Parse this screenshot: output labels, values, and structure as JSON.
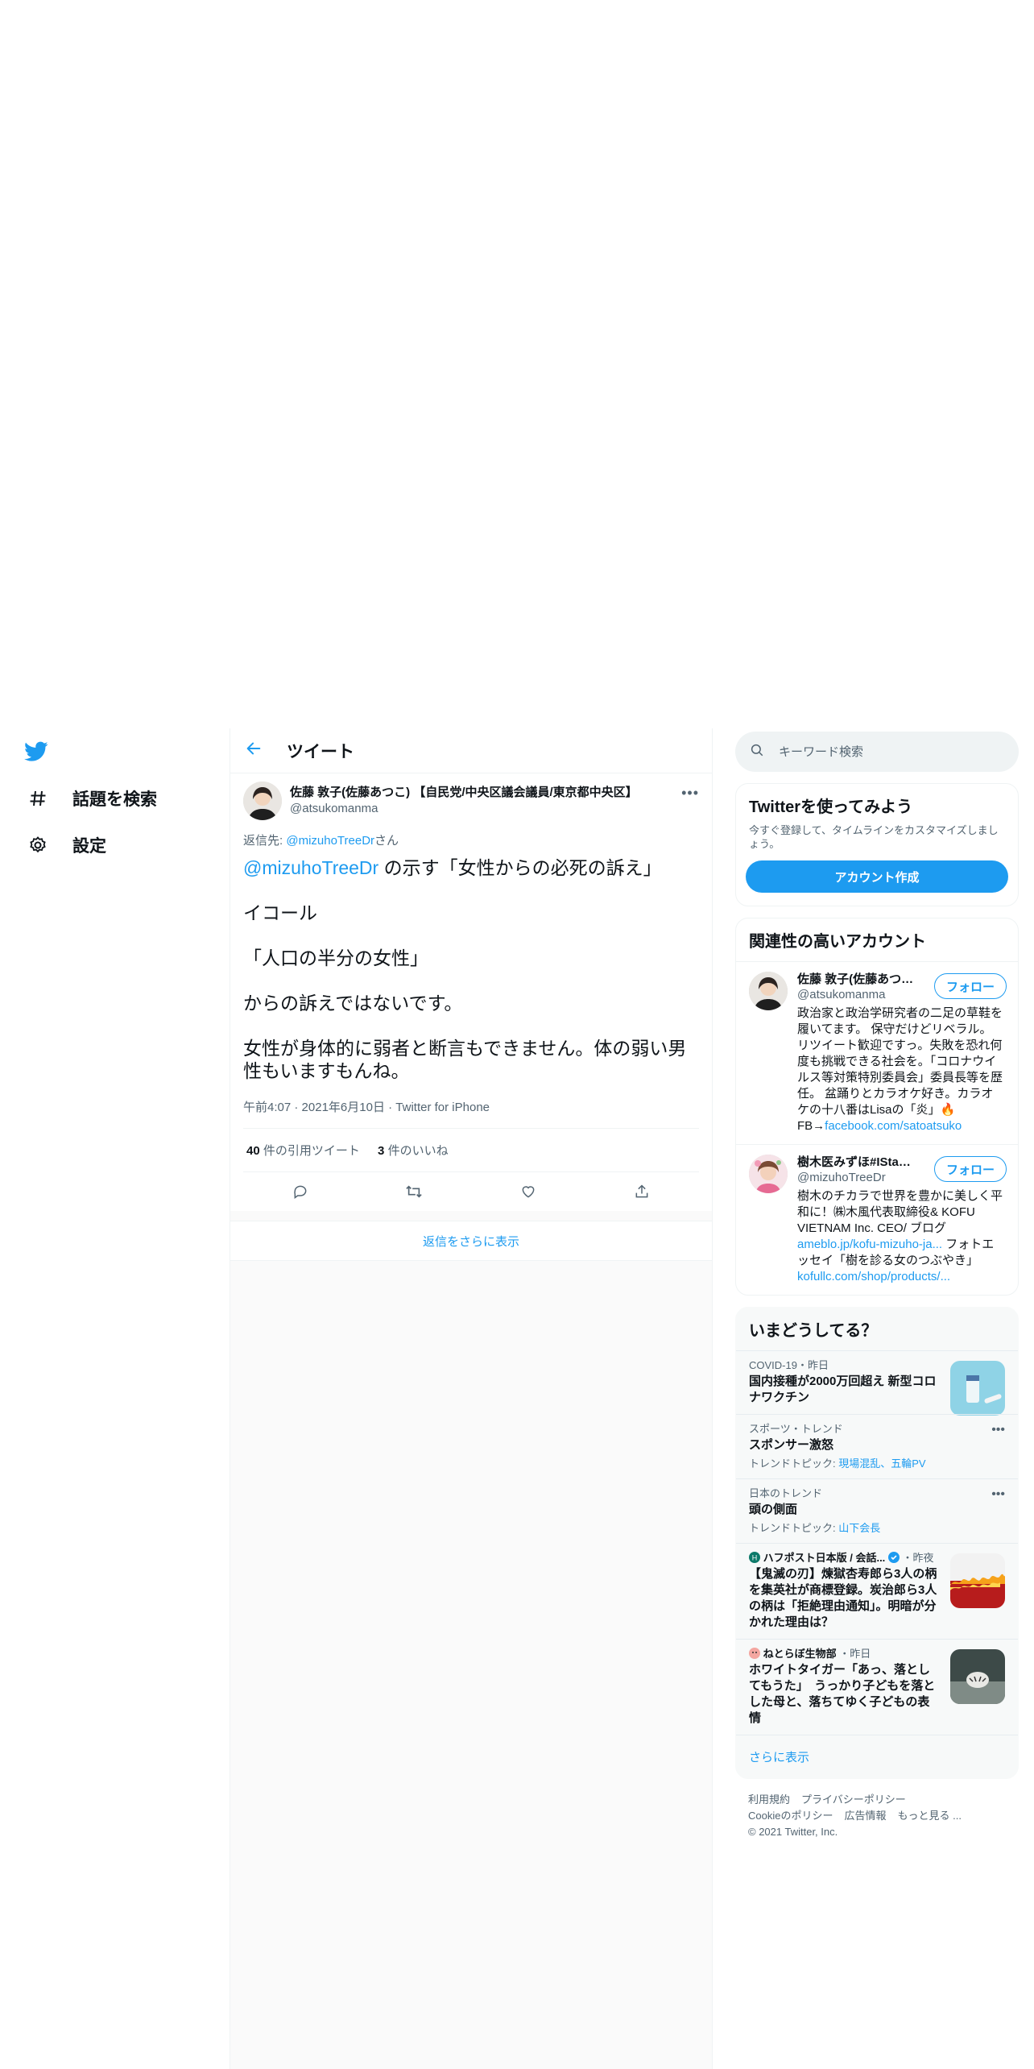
{
  "nav": {
    "logo": "twitter-bird",
    "items": [
      {
        "icon": "hash-icon",
        "label": "話題を検索"
      },
      {
        "icon": "gear-icon",
        "label": "設定"
      }
    ]
  },
  "header": {
    "title": "ツイート"
  },
  "tweet": {
    "author_name": "佐藤 敦子(佐藤あつこ) 【自民党/中央区議会議員/東京都中央区】",
    "author_handle": "@atsukomanma",
    "reply_prefix": "返信先: ",
    "reply_handle": "@mizuhoTreeDr",
    "reply_suffix": "さん",
    "mention": "@mizuhoTreeDr",
    "line1_rest": " の示す「女性からの必死の訴え」",
    "line2": "イコール",
    "line3": "「人口の半分の女性」",
    "line4": "からの訴えではないです。",
    "line5": "女性が身体的に弱者と断言もできません。体の弱い男性もいますもんね。",
    "time": "午前4:07",
    "date": "2021年6月10日",
    "source": "Twitter for iPhone",
    "quote_count": "40",
    "quote_label": "件の引用ツイート",
    "like_count": "3",
    "like_label": "件のいいね"
  },
  "more_replies": "返信をさらに表示",
  "search": {
    "placeholder": "キーワード検索"
  },
  "signup": {
    "title": "Twitterを使ってみよう",
    "desc": "今すぐ登録して、タイムラインをカスタマイズしましょう。",
    "button": "アカウント作成"
  },
  "related": {
    "title": "関連性の高いアカウント",
    "follow_label": "フォロー",
    "accounts": [
      {
        "name": "佐藤 敦子(佐藤あつこ) 【自民党/中央区議会議員/東京都中央区】",
        "handle": "@atsukomanma",
        "bio": "政治家と政治学研究者の二足の草鞋を履いてます。 保守だけどリベラル。 リツイート歓迎ですっ。失敗を恐れ何度も挑戦できる社会を。「コロナウイルス等対策特別委員会」委員長等を歴任。 盆踊りとカラオケ好き。カラオケの十八番はLisaの「炎」🔥",
        "bio_link_prefix": "FB→",
        "bio_link": "facebook.com/satoatsuko"
      },
      {
        "name": "樹木医みずほ#IStandWithUkraine",
        "handle": "@mizuhoTreeDr",
        "bio": "樹木のチカラで世界を豊かに美しく平和に！㈱木風代表取締役& KOFU VIETNAM Inc. CEO/ ブログ",
        "bio_link": "ameblo.jp/kofu-mizuho-ja...",
        "bio_mid": " フォトエッセイ「樹を診る女のつぶやき」",
        "bio_link2": "kofullc.com/shop/products/..."
      }
    ]
  },
  "trends": {
    "title": "いまどうしてる？",
    "items": [
      {
        "context": "COVID-19・昨日",
        "title": "国内接種が2000万回超え 新型コロナワクチン",
        "thumb": "vaccine-photo"
      },
      {
        "context": "スポーツ・トレンド",
        "title": "スポンサー激怒",
        "sub_prefix": "トレンドトピック: ",
        "sub": "現場混乱、五輪PV"
      },
      {
        "context": "日本のトレンド",
        "title": "頭の側面",
        "sub_prefix": "トレンドトピック: ",
        "sub": "山下会長"
      },
      {
        "source": "ハフポスト日本版 / 会話...",
        "time": "・昨夜",
        "title": "【鬼滅の刃】煉獄杏寿郎ら3人の柄を集英社が商標登録。炭治郎ら3人の柄は「拒絶理由通知」。明暗が分かれた理由は？",
        "thumb": "flame-pattern"
      },
      {
        "source": "ねとらぼ生物部",
        "time": "・昨日",
        "title": "ホワイトタイガー「あっ、落としてもうた」　うっかり子どもを落とした母と、落ちてゆく子どもの表情",
        "thumb": "tiger-photo"
      }
    ],
    "show_more": "さらに表示"
  },
  "footer": {
    "links": [
      "利用規約",
      "プライバシーポリシー",
      "Cookieのポリシー",
      "広告情報",
      "もっと見る ..."
    ],
    "copyright": "© 2021 Twitter, Inc."
  },
  "colors": {
    "accent": "#1d9bf0",
    "text": "#0f1419",
    "muted": "#536471"
  }
}
